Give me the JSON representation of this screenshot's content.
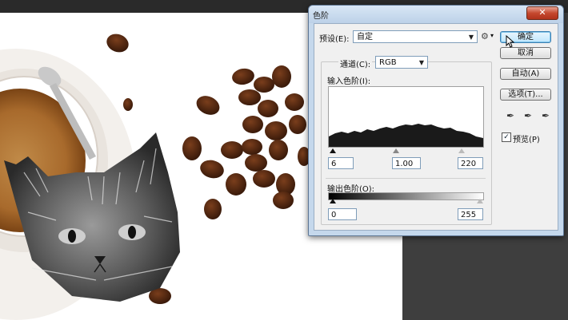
{
  "dialog": {
    "title": "色阶",
    "close_icon": "close-icon"
  },
  "preset": {
    "label": "预设(E):",
    "value": "自定"
  },
  "channel": {
    "label": "通道(C):",
    "value": "RGB"
  },
  "input_levels": {
    "label": "输入色阶(I):",
    "black": "6",
    "gamma": "1.00",
    "white": "220"
  },
  "output_levels": {
    "label": "输出色阶(O):",
    "black": "0",
    "white": "255"
  },
  "buttons": {
    "ok": "确定",
    "cancel": "取消",
    "auto": "自动(A)",
    "options": "选项(T)..."
  },
  "preview": {
    "label": "预览(P)",
    "checked": true
  },
  "icons": {
    "eyedropper_black": "eyedropper-black-icon",
    "eyedropper_gray": "eyedropper-gray-icon",
    "eyedropper_white": "eyedropper-white-icon",
    "gear": "gear-icon",
    "cursor": "mouse-cursor-icon"
  },
  "colors": {
    "dialog_frame": "#c5d8ec",
    "close_button": "#c5482e",
    "workspace": "#3e3e3e"
  }
}
